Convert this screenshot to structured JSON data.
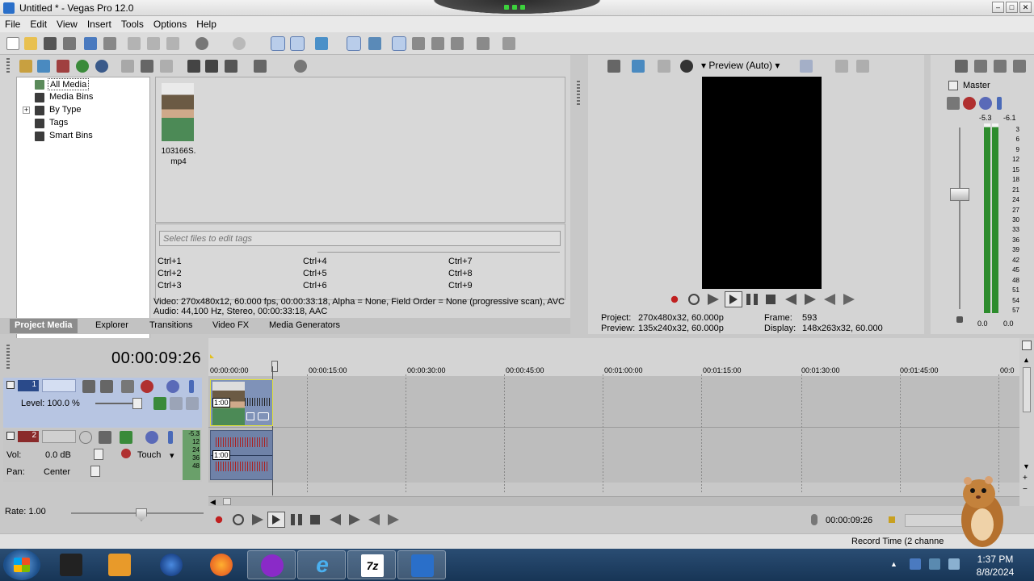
{
  "window": {
    "title": "Untitled * - Vegas Pro 12.0",
    "min": "–",
    "max": "□",
    "close": "✕"
  },
  "menu": [
    "File",
    "Edit",
    "View",
    "Insert",
    "Tools",
    "Options",
    "Help"
  ],
  "project_media": {
    "tree": [
      "All Media",
      "Media Bins",
      "By Type",
      "Tags",
      "Smart Bins"
    ],
    "tree_expander": "+",
    "file": {
      "name_line1": "103166S.",
      "name_line2": "mp4"
    },
    "tag_placeholder": "Select files to edit tags",
    "shortcuts": [
      "Ctrl+1",
      "Ctrl+2",
      "Ctrl+3",
      "Ctrl+4",
      "Ctrl+5",
      "Ctrl+6",
      "Ctrl+7",
      "Ctrl+8",
      "Ctrl+9"
    ],
    "info_video": "Video: 270x480x12, 60.000 fps, 00:00:33:18, Alpha = None, Field Order = None (progressive scan), AVC",
    "info_audio": "Audio: 44,100 Hz, Stereo, 00:00:33:18, AAC",
    "tabs": [
      "Project Media",
      "Explorer",
      "Transitions",
      "Video FX",
      "Media Generators"
    ]
  },
  "preview": {
    "mode": "Preview (Auto)",
    "project_label": "Project:",
    "project_value": "270x480x32, 60.000p",
    "preview_label": "Preview:",
    "preview_value": "135x240x32, 60.000p",
    "frame_label": "Frame:",
    "frame_value": "593",
    "display_label": "Display:",
    "display_value": "148x263x32, 60.000"
  },
  "master": {
    "label": "Master",
    "peak_left": "-5.3",
    "peak_right": "-6.1",
    "scale": [
      "3",
      "6",
      "9",
      "12",
      "15",
      "18",
      "21",
      "24",
      "27",
      "30",
      "33",
      "36",
      "39",
      "42",
      "45",
      "48",
      "51",
      "54",
      "57"
    ],
    "bottom_left": "0.0",
    "bottom_right": "0.0"
  },
  "timeline": {
    "current_time": "00:00:09:26",
    "ruler": [
      "00:00:00:00",
      "00:00:15:00",
      "00:00:30:00",
      "00:00:45:00",
      "00:01:00:00",
      "00:01:15:00",
      "00:01:30:00",
      "00:01:45:00",
      "00:0"
    ],
    "video_track": {
      "number": "1",
      "level": "Level: 100.0 %",
      "clip_tag": "1:00"
    },
    "audio_track": {
      "number": "2",
      "vol_label": "Vol:",
      "vol_value": "0.0 dB",
      "automation": "Touch",
      "pan_label": "Pan:",
      "pan_value": "Center",
      "meter": [
        "-5.3",
        "12",
        "24",
        "36",
        "48"
      ],
      "clip_tag": "1:00"
    },
    "rate": "Rate: 1.00",
    "transport_time": "00:00:09:26"
  },
  "statusbar": {
    "text": "Record Time (2 channe"
  },
  "taskbar": {
    "time": "1:37 PM",
    "date": "8/8/2024",
    "ie_letter": "e",
    "zip_label": "7z"
  },
  "colors": {
    "accent": "#2a6fc9",
    "track_video": "#b7c5e2",
    "clip_border": "#e2e23a",
    "meter": "#2d8c2d",
    "taskbar": "#1f4063"
  }
}
